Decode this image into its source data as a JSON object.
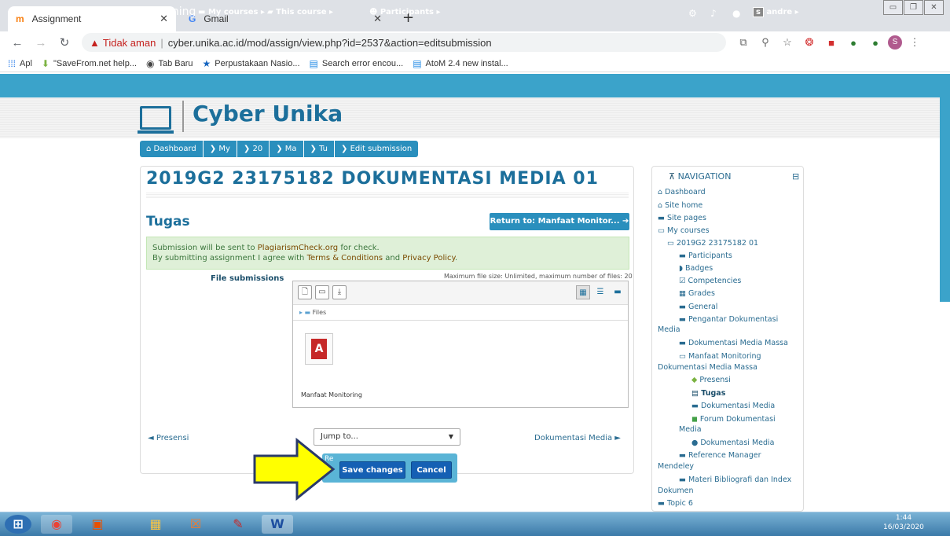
{
  "browser": {
    "tabs": [
      {
        "label": "Assignment",
        "favicon": "moodle-icon"
      },
      {
        "label": "Gmail",
        "favicon": "gmail-icon"
      }
    ],
    "address": {
      "warning": "Tidak aman",
      "url": "cyber.unika.ac.id/mod/assign/view.php?id=2537&action=editsubmission"
    },
    "bookmarks": [
      "Apl",
      "\"SaveFrom.net help...",
      "Tab Baru",
      "Perpustakaan Nasio...",
      "Search error encou...",
      "AtoM 2.4 new instal..."
    ],
    "profile_initial": "S"
  },
  "moodle": {
    "brand": "eLearning",
    "menu": [
      "My courses ▸",
      "This course ▸",
      "Participants ▸"
    ],
    "user": "andre ▸",
    "user_initial": "s",
    "site_name": "Cyber Unika",
    "breadcrumbs": [
      "Dashboard",
      "My",
      "20",
      "Ma",
      "Tu",
      "Edit submission"
    ]
  },
  "main": {
    "title": "2019G2 23175182 DOKUMENTASI MEDIA 01",
    "subtitle": "Tugas",
    "return_button": "Return to: Manfaat Monitor...",
    "notice_line1_a": "Submission will be sent to ",
    "notice_line1_link": "PlagiarismCheck.org",
    "notice_line1_b": " for check.",
    "notice_line2_a": "By submitting assignment I agree with ",
    "notice_line2_link1": "Terms & Conditions",
    "notice_line2_mid": " and ",
    "notice_line2_link2": "Privacy Policy",
    "notice_line2_end": ".",
    "file_label": "File submissions",
    "max_size": "Maximum file size: Unlimited, maximum number of files: 20",
    "files_path": "Files",
    "file_name": "Manfaat Monitoring",
    "prev_link": "◄ Presensi",
    "jump_to": "Jump to...",
    "next_link": "Dokumentasi Media ►",
    "r_label": "Re",
    "save_button": "Save changes",
    "cancel_button": "Cancel"
  },
  "nav": {
    "title": "NAVIGATION",
    "collapse": "⊟",
    "items": [
      "Dashboard",
      "Site home",
      "Site pages",
      "My courses",
      "2019G2 23175182 01",
      "Participants",
      "Badges",
      "Competencies",
      "Grades",
      "General",
      "Pengantar Dokumentasi",
      "Media",
      "Dokumentasi Media Massa",
      "Manfaat Monitoring",
      "Dokumentasi Media Massa",
      "Presensi",
      "Tugas",
      "Dokumentasi Media",
      "Forum Dokumentasi",
      "Media",
      "Dokumentasi Media",
      "Reference Manager",
      "Mendeley",
      "Materi Bibliografi dan Index",
      "Dokumen",
      "Topic 6"
    ]
  },
  "taskbar": {
    "time": "1:44",
    "date": "16/03/2020"
  }
}
